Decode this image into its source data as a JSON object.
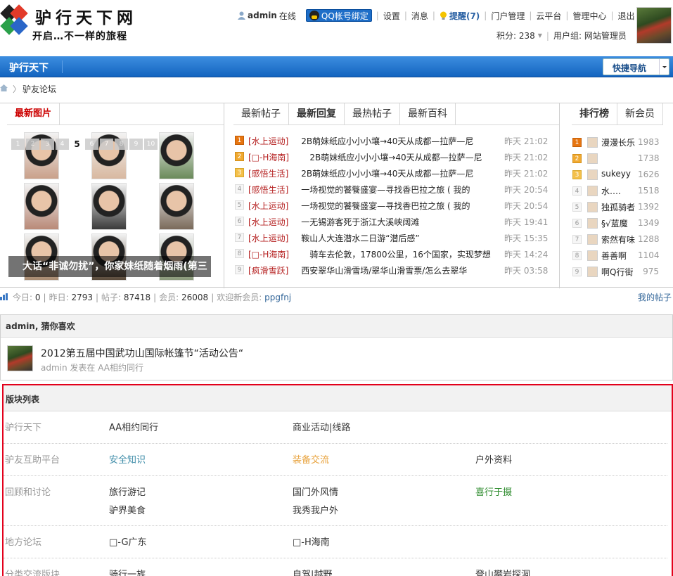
{
  "header": {
    "brand": "驴行天下网",
    "slogan": "开启…不一样的旅程"
  },
  "topbar": {
    "username": "admin",
    "online": "在线",
    "qq_bind": "QQ帐号绑定",
    "settings": "设置",
    "messages": "消息",
    "remind": "提醒(7)",
    "portal_admin": "门户管理",
    "cloud": "云平台",
    "admin_center": "管理中心",
    "logout": "退出",
    "points": "积分: 238",
    "usergroup": "用户组: 网站管理员"
  },
  "nav": {
    "home": "驴行天下",
    "quick_nav": "快捷导航"
  },
  "breadcrumb": {
    "current": "驴友论坛"
  },
  "picture_panel": {
    "tab": "最新图片",
    "pager": [
      "1",
      "2",
      "3",
      "4",
      "5",
      "6",
      "7",
      "8",
      "9",
      "10"
    ],
    "current_page": "5",
    "caption": "大话“非诚勿扰”，你家妹纸随着烟雨(第三"
  },
  "thread_tabs": [
    "最新帖子",
    "最新回复",
    "最热帖子",
    "最新百科"
  ],
  "threads": [
    {
      "n": "1",
      "cat": "[水上运动]",
      "title": "2B萌妹纸应小小小壤→40天从成都—拉萨—尼",
      "time": "昨天 21:02"
    },
    {
      "n": "2",
      "cat": "[□-H海南]",
      "title": "2B萌妹纸应小小小壤→40天从成都—拉萨—尼",
      "time": "昨天 21:02"
    },
    {
      "n": "3",
      "cat": "[感悟生活]",
      "title": "2B萌妹纸应小小小壤→40天从成都—拉萨—尼",
      "time": "昨天 21:02"
    },
    {
      "n": "4",
      "cat": "[感悟生活]",
      "title": "一场视觉的饕餮盛宴—寻找香巴拉之旅 ( 我的",
      "time": "昨天 20:54"
    },
    {
      "n": "5",
      "cat": "[水上运动]",
      "title": "一场视觉的饕餮盛宴—寻找香巴拉之旅 ( 我的",
      "time": "昨天 20:54"
    },
    {
      "n": "6",
      "cat": "[水上运动]",
      "title": "一无锡游客死于浙江大溪峡阔滩",
      "time": "昨天 19:41"
    },
    {
      "n": "7",
      "cat": "[水上运动]",
      "title": "鞍山人大连潜水二日游“潜后感”",
      "time": "昨天 15:35"
    },
    {
      "n": "8",
      "cat": "[□-H海南]",
      "title": "骑车去伦敦，17800公里，16个国家，实现梦想",
      "time": "昨天 14:24"
    },
    {
      "n": "9",
      "cat": "[疯滑雪跃]",
      "title": "西安翠华山滑雪场/翠华山滑雪票/怎么去翠华",
      "time": "昨天 03:58"
    }
  ],
  "rank_tabs": [
    "排行榜",
    "新会员"
  ],
  "ranking": [
    {
      "n": "1",
      "name": "漫漫长乐",
      "score": "1983"
    },
    {
      "n": "2",
      "name": "",
      "score": "1738"
    },
    {
      "n": "3",
      "name": "sukeyy",
      "score": "1626"
    },
    {
      "n": "4",
      "name": "水….",
      "score": "1518"
    },
    {
      "n": "5",
      "name": "独孤骑者",
      "score": "1392"
    },
    {
      "n": "6",
      "name": "§√蓝魔",
      "score": "1349"
    },
    {
      "n": "7",
      "name": "索然有味",
      "score": "1288"
    },
    {
      "n": "8",
      "name": "善善啊",
      "score": "1104"
    },
    {
      "n": "9",
      "name": "啊Q行街",
      "score": "975"
    }
  ],
  "stats": {
    "today_label": "今日:",
    "today": "0",
    "yesterday_label": "昨日:",
    "yesterday": "2793",
    "posts_label": "帖子:",
    "posts": "87418",
    "members_label": "会员:",
    "members": "26008",
    "welcome": "欢迎新会员:",
    "newest": "ppgfnj",
    "my_posts": "我的帖子"
  },
  "guess": {
    "heading": "admin, 猜你喜欢",
    "title": "2012第五届中国武功山国际帐篷节“活动公告“",
    "meta": "admin 发表在 AA相约同行"
  },
  "forums": {
    "heading": "版块列表",
    "rows": [
      {
        "name": "驴行天下",
        "links": [
          "AA相约同行",
          "商业活动|线路"
        ]
      },
      {
        "name": "驴友互助平台",
        "links": [
          "安全知识",
          "装备交流",
          "户外资料"
        ]
      },
      {
        "name": "回顾和讨论",
        "links": [
          "旅行游记",
          "国门外风情",
          "喜行于摄",
          "驴界美食",
          "我秀我户外"
        ]
      },
      {
        "name": "地方论坛",
        "links": [
          "□-G广东",
          "□-H海南"
        ]
      },
      {
        "name": "分类交流版块",
        "links": [
          "骑行一族",
          "自驾|越野",
          "登山攀岩探洞"
        ]
      }
    ]
  },
  "colors": {
    "nav_blue": "#1e6fcc",
    "remind": "#2b62a4",
    "category_red": "#b52020",
    "link_blue": "#336699",
    "forum_teal": "#3e8ca8",
    "forum_orange": "#e8a13a",
    "forum_green": "#2b8a2b",
    "highlight_red": "#e3001b"
  }
}
